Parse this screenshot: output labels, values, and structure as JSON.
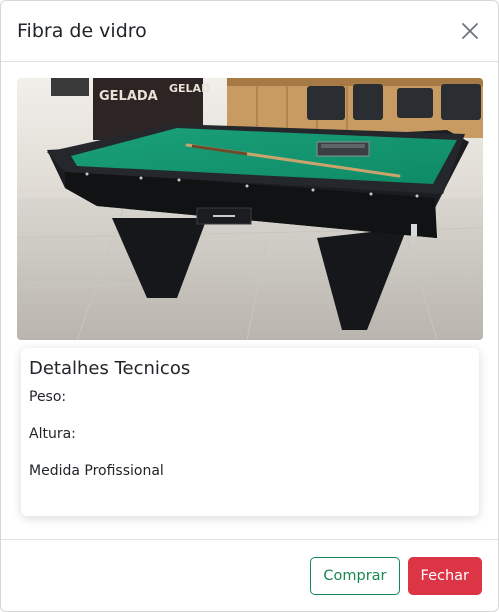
{
  "modal": {
    "title": "Fibra de vidro",
    "close_icon": "close-icon"
  },
  "image": {
    "subject": "pool-table-photo",
    "banner_text_left": "GELADA",
    "banner_text_right": "GELAD"
  },
  "details": {
    "title": "Detalhes Tecnicos",
    "weight_label": "Peso:",
    "height_label": "Altura:",
    "size_label": "Medida Profissional"
  },
  "footer": {
    "buy_label": "Comprar",
    "close_label": "Fechar"
  },
  "colors": {
    "buy_accent": "#198754",
    "close_accent": "#dc3545",
    "felt": "#129a73"
  }
}
